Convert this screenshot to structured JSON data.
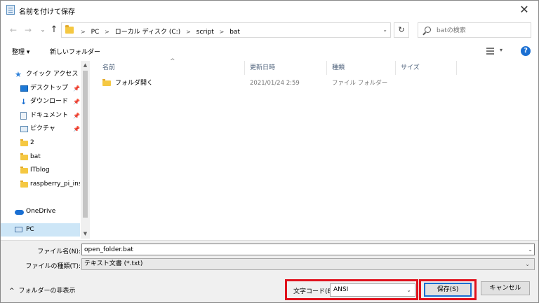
{
  "window": {
    "title": "名前を付けて保存",
    "close": "✕"
  },
  "address": {
    "back": "←",
    "forward": "→",
    "history": "⌄",
    "up": "↑",
    "crumbs": [
      "PC",
      "ローカル ディスク (C:)",
      "script",
      "bat"
    ],
    "separator": ">",
    "dropdown": "⌄",
    "refresh": "↻",
    "search_placeholder": "batの検索"
  },
  "toolbar": {
    "organize": "整理 ▾",
    "new_folder": "新しいフォルダー",
    "view_dropdown": "▾",
    "help": "?"
  },
  "navpane": {
    "items": [
      {
        "label": "クイック アクセス",
        "icon": "star-icon",
        "top": true,
        "pinned": false
      },
      {
        "label": "デスクトップ",
        "icon": "desktop-icon",
        "top": false,
        "pinned": true
      },
      {
        "label": "ダウンロード",
        "icon": "download-icon",
        "top": false,
        "pinned": true
      },
      {
        "label": "ドキュメント",
        "icon": "document-icon",
        "top": false,
        "pinned": true
      },
      {
        "label": "ピクチャ",
        "icon": "pictures-icon",
        "top": false,
        "pinned": true
      },
      {
        "label": "2",
        "icon": "folder-icon",
        "top": false,
        "pinned": false
      },
      {
        "label": "bat",
        "icon": "folder-icon",
        "top": false,
        "pinned": false
      },
      {
        "label": "ITblog",
        "icon": "folder-icon",
        "top": false,
        "pinned": false
      },
      {
        "label": "raspberry_pi_inst",
        "icon": "folder-icon",
        "top": false,
        "pinned": false
      },
      {
        "label": "",
        "icon": "",
        "top": true,
        "pinned": false
      },
      {
        "label": "OneDrive",
        "icon": "cloud-icon",
        "top": true,
        "pinned": false
      },
      {
        "label": "",
        "icon": "",
        "top": true,
        "pinned": false
      },
      {
        "label": "PC",
        "icon": "pc-icon",
        "top": true,
        "pinned": false,
        "selected": true
      }
    ],
    "scroll_up": "▲",
    "scroll_down": "▼"
  },
  "filelist": {
    "columns": {
      "name": "名前",
      "date": "更新日時",
      "type": "種類",
      "size": "サイズ"
    },
    "sort_indicator": "^",
    "rows": [
      {
        "name": "フォルダ開く",
        "date": "2021/01/24 2:59",
        "type": "ファイル フォルダー",
        "size": ""
      }
    ]
  },
  "bottom": {
    "filename_label": "ファイル名(N):",
    "filename_value": "open_folder.bat",
    "filetype_label": "ファイルの種類(T):",
    "filetype_value": "テキスト文書 (*.txt)",
    "dropdown": "⌄",
    "hide_folders": "フォルダーの非表示",
    "hide_chevron": "^",
    "encoding_label": "文字コード(E):",
    "encoding_value": "ANSI",
    "save": "保存(S)",
    "cancel": "キャンセル"
  },
  "colors": {
    "accent": "#1a6fd2",
    "highlight": "#e0121c",
    "selected": "#cde6f7",
    "folder": "#f5c842"
  }
}
